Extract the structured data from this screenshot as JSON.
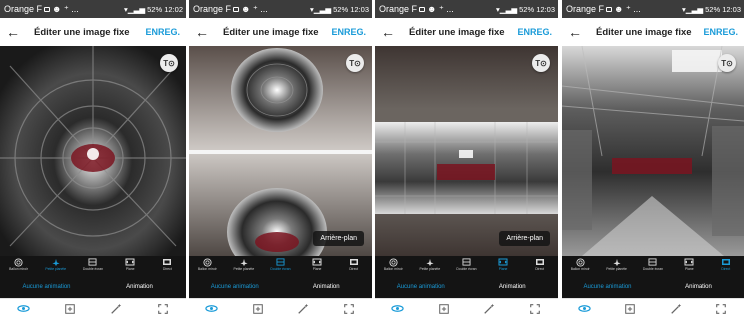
{
  "colors": {
    "accent": "#1a9bd8",
    "statusbar": "#3c3c3c",
    "panel": "#141414"
  },
  "screens": [
    {
      "status": {
        "carrier": "Orange F",
        "right": "52% 12:02",
        "time": "12:02"
      },
      "header": {
        "title": "Éditer une image fixe",
        "save": "ENREG."
      },
      "fab_icon": "rotate-lock-icon",
      "chip": "",
      "modes": [
        {
          "label": "Ballon miroir",
          "icon": "mirror-ball-icon"
        },
        {
          "label": "Petite planète",
          "icon": "little-planet-icon"
        },
        {
          "label": "Double écran",
          "icon": "double-screen-icon"
        },
        {
          "label": "Plane",
          "icon": "plane-icon"
        },
        {
          "label": "Direct",
          "icon": "direct-icon"
        }
      ],
      "active_mode": 1,
      "tabs": {
        "left": "Aucune animation",
        "right": "Animation"
      }
    },
    {
      "status": {
        "carrier": "Orange F",
        "right": "52% 12:03",
        "time": "12:03"
      },
      "header": {
        "title": "Éditer une image fixe",
        "save": "ENREG."
      },
      "fab_icon": "rotate-lock-icon",
      "chip": "Arrière-plan",
      "modes": [
        {
          "label": "Ballon miroir",
          "icon": "mirror-ball-icon"
        },
        {
          "label": "Petite planète",
          "icon": "little-planet-icon"
        },
        {
          "label": "Double écran",
          "icon": "double-screen-icon"
        },
        {
          "label": "Plane",
          "icon": "plane-icon"
        },
        {
          "label": "Direct",
          "icon": "direct-icon"
        }
      ],
      "active_mode": 2,
      "tabs": {
        "left": "Aucune animation",
        "right": "Animation"
      }
    },
    {
      "status": {
        "carrier": "Orange F",
        "right": "52% 12:03",
        "time": "12:03"
      },
      "header": {
        "title": "Éditer une image fixe",
        "save": "ENREG."
      },
      "fab_icon": "rotate-lock-icon",
      "chip": "Arrière-plan",
      "modes": [
        {
          "label": "Ballon miroir",
          "icon": "mirror-ball-icon"
        },
        {
          "label": "Petite planète",
          "icon": "little-planet-icon"
        },
        {
          "label": "Double écran",
          "icon": "double-screen-icon"
        },
        {
          "label": "Plane",
          "icon": "plane-icon"
        },
        {
          "label": "Direct",
          "icon": "direct-icon"
        }
      ],
      "active_mode": 3,
      "tabs": {
        "left": "Aucune animation",
        "right": "Animation"
      }
    },
    {
      "status": {
        "carrier": "Orange F",
        "right": "52% 12:03",
        "time": "12:03"
      },
      "header": {
        "title": "Éditer une image fixe",
        "save": "ENREG."
      },
      "fab_icon": "rotate-lock-icon",
      "chip": "",
      "modes": [
        {
          "label": "Ballon miroir",
          "icon": "mirror-ball-icon"
        },
        {
          "label": "Petite planète",
          "icon": "little-planet-icon"
        },
        {
          "label": "Double écran",
          "icon": "double-screen-icon"
        },
        {
          "label": "Plane",
          "icon": "plane-icon"
        },
        {
          "label": "Direct",
          "icon": "direct-icon"
        }
      ],
      "active_mode": 4,
      "tabs": {
        "left": "Aucune animation",
        "right": "Animation"
      }
    }
  ],
  "bottom_nav": [
    "view-360-icon",
    "add-frame-icon",
    "magic-wand-icon",
    "fullscreen-icon"
  ]
}
